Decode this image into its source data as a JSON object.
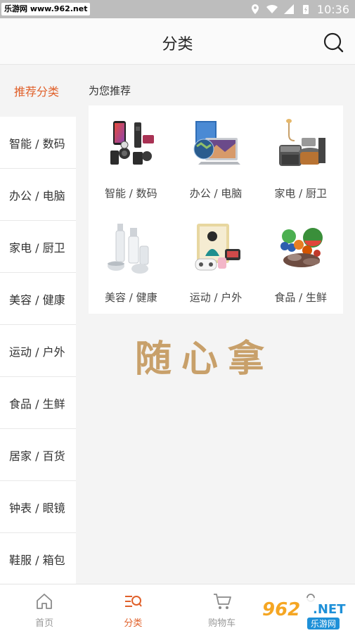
{
  "status": {
    "watermark": "乐游网 www.962.net",
    "time": "10:36"
  },
  "header": {
    "title": "分类"
  },
  "sidebar": {
    "items": [
      {
        "label": "推荐分类"
      },
      {
        "label": "智能 / 数码"
      },
      {
        "label": "办公 / 电脑"
      },
      {
        "label": "家电 / 厨卫"
      },
      {
        "label": "美容 / 健康"
      },
      {
        "label": "运动 / 户外"
      },
      {
        "label": "食品 / 生鲜"
      },
      {
        "label": "居家 / 百货"
      },
      {
        "label": "钟表 / 眼镜"
      },
      {
        "label": "鞋服 / 箱包"
      }
    ]
  },
  "main": {
    "section_title": "为您推荐",
    "categories": [
      {
        "label": "智能 / 数码"
      },
      {
        "label": "办公 / 电脑"
      },
      {
        "label": "家电 / 厨卫"
      },
      {
        "label": "美容 / 健康"
      },
      {
        "label": "运动 / 户外"
      },
      {
        "label": "食品 / 生鲜"
      }
    ],
    "brand_watermark": "随心拿"
  },
  "tabbar": {
    "tabs": [
      {
        "label": "首页",
        "icon": "home-icon"
      },
      {
        "label": "分类",
        "icon": "category-icon"
      },
      {
        "label": "购物车",
        "icon": "cart-icon"
      }
    ]
  },
  "corner_watermark": {
    "number": "962",
    "net": ".NET",
    "cn": "乐游网"
  },
  "colors": {
    "accent": "#e0602a",
    "brand_gold": "#c8a06a"
  }
}
